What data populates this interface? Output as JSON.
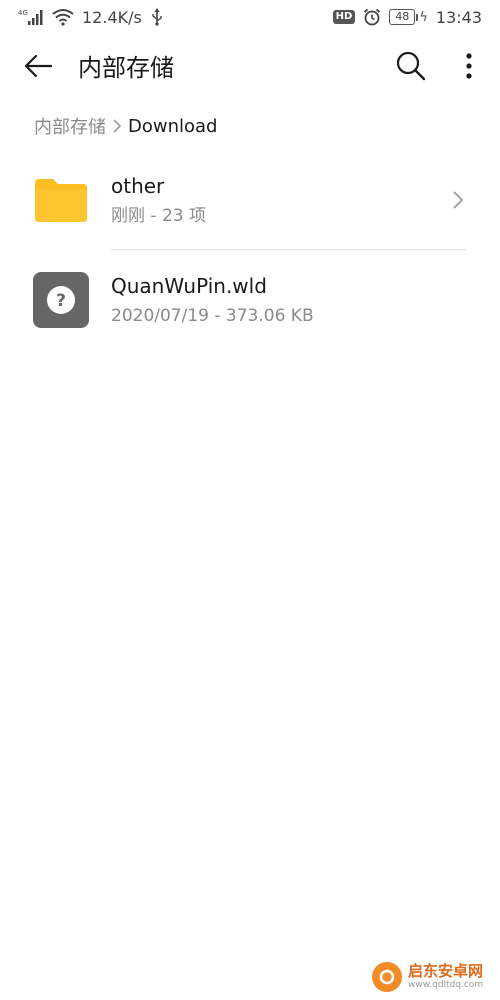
{
  "status_bar": {
    "network_type": "4G",
    "speed": "12.4K/s",
    "hd_badge": "HD",
    "battery_level": "48",
    "time": "13:43",
    "icons": [
      "signal-icon",
      "wifi-icon",
      "usb-icon",
      "hd-icon",
      "alarm-icon",
      "battery-icon",
      "charging-icon"
    ]
  },
  "app_bar": {
    "title": "内部存储",
    "icons": [
      "back-arrow-icon",
      "search-icon",
      "more-vertical-icon"
    ]
  },
  "breadcrumb": {
    "root": "内部存储",
    "current": "Download"
  },
  "files": [
    {
      "name": "other",
      "meta": "刚刚 - 23 项",
      "type": "folder",
      "icon": "folder-icon",
      "color": "#FBBF24"
    },
    {
      "name": "QuanWuPin.wld",
      "meta": "2020/07/19 - 373.06 KB",
      "type": "unknown-file",
      "icon": "unknown-file-icon",
      "color": "#666666"
    }
  ],
  "watermark": {
    "title": "启东安卓网",
    "url": "www.qdltdq.com"
  },
  "colors": {
    "folder": "#FBBF24",
    "unknown_file": "#666666",
    "text_primary": "#1a1a1a",
    "text_secondary": "#8a8a8a",
    "divider": "#e2e2e2",
    "watermark_accent": "#f28c28"
  }
}
